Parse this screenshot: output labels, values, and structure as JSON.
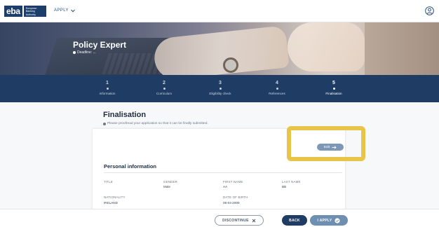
{
  "header": {
    "logo_mark": "eba",
    "logo_lines": [
      "European",
      "Banking",
      "Authority"
    ],
    "apply_menu": "APPLY",
    "icons": {
      "apply_menu": "chevron-down-icon",
      "user": "user-circle-icon"
    }
  },
  "hero": {
    "title": "Policy Expert",
    "subtitle": "Deadline: ..."
  },
  "stepper": {
    "steps": [
      {
        "number": "1",
        "label": "Information"
      },
      {
        "number": "2",
        "label": "Curriculum"
      },
      {
        "number": "3",
        "label": "Eligibility check"
      },
      {
        "number": "4",
        "label": "References"
      },
      {
        "number": "5",
        "label": "Finalisation"
      }
    ],
    "active_index": 4
  },
  "finalisation": {
    "title": "Finalisation",
    "note": "Please proofread your application so that it can be finally submitted.",
    "edit_label": "Edit"
  },
  "personal_information": {
    "title": "Personal information",
    "fields": [
      {
        "label": "TITLE",
        "value": ""
      },
      {
        "label": "GENDER",
        "value": "Male"
      },
      {
        "label": "FIRST NAME",
        "value": "AA"
      },
      {
        "label": "LAST NAME",
        "value": "BB"
      },
      {
        "label": "NATIONALITY",
        "value": "IRELAND"
      },
      {
        "label": "DATE OF BIRTH",
        "value": "08-04-2009"
      }
    ]
  },
  "actions": {
    "discontinue": "DISCONTINUE",
    "back": "BACK",
    "apply": "I APPLY"
  },
  "colors": {
    "primary": "#1f3d64",
    "accent": "#6f8fb2",
    "highlight": "#e8c549"
  }
}
